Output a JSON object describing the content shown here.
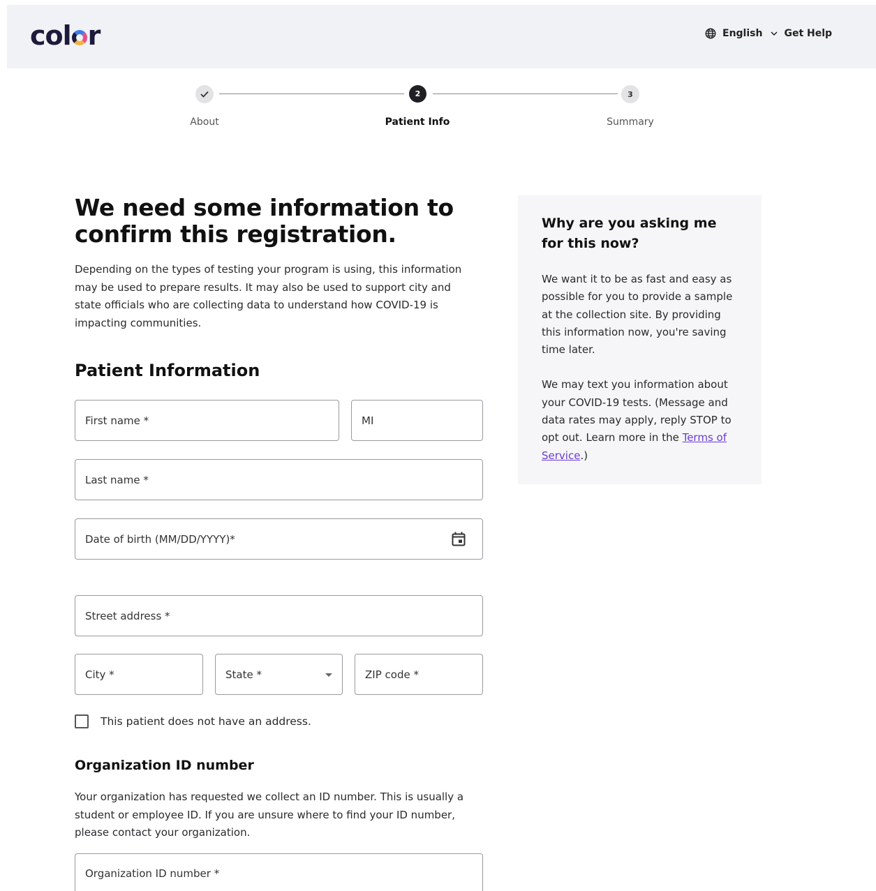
{
  "header": {
    "logo_text_pre": "col",
    "logo_text_post": "r",
    "language": "English",
    "help": "Get Help"
  },
  "stepper": {
    "steps": [
      {
        "label": "About",
        "marker": "",
        "state": "done"
      },
      {
        "label": "Patient Info",
        "marker": "2",
        "state": "current"
      },
      {
        "label": "Summary",
        "marker": "3",
        "state": "upcoming"
      }
    ]
  },
  "main": {
    "headline": "We need some information to confirm this registration.",
    "intro": "Depending on the types of testing your program is using, this information may be used to prepare results. It may also be used to support city and state officials who are collecting data to understand how COVID-19 is impacting communities.",
    "section_title": "Patient Information",
    "fields": {
      "first_name": "First name *",
      "mi": "MI",
      "last_name": "Last name *",
      "dob": "Date of birth (MM/DD/YYYY)*",
      "street": "Street address *",
      "city": "City *",
      "state": "State *",
      "zip": "ZIP code *"
    },
    "no_address_label": "This patient does not have an address.",
    "org": {
      "title": "Organization ID number",
      "desc": "Your organization has requested we collect an ID number. This is usually a student or employee ID. If you are unsure where to find your ID number, please contact your organization.",
      "field": "Organization ID number *"
    }
  },
  "aside": {
    "title": "Why are you asking me for this now?",
    "p1": "We want it to be as fast and easy as possible for you to provide a sample at the collection site. By providing this information now, you're saving time later.",
    "p2_pre": "We may text you information about your COVID-19 tests. (Message and data rates may apply, reply STOP to opt out. Learn more in the ",
    "p2_link": "Terms of Service",
    "p2_post": ".)"
  },
  "colors": {
    "header_bg": "#f1f2f6",
    "link": "#6b3ad8",
    "step_current": "#1f2024"
  }
}
